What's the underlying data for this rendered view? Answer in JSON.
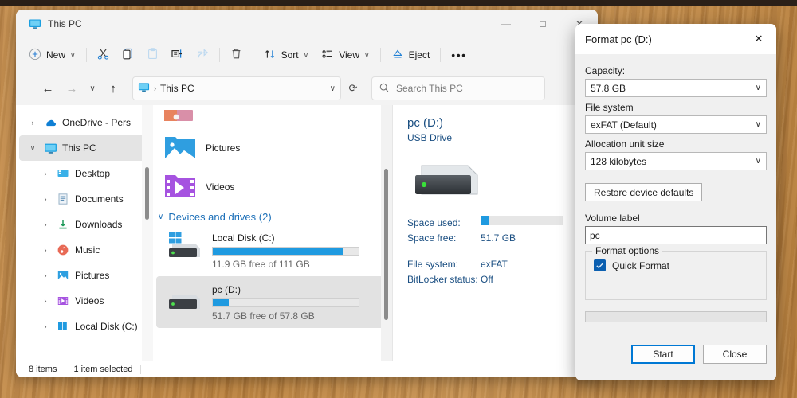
{
  "window": {
    "title": "This PC",
    "title_icon": "monitor-icon",
    "controls": {
      "minimize": "—",
      "maximize": "□",
      "close": "✕"
    }
  },
  "toolbar": {
    "new_label": "New",
    "new_icon": "plus-circle-icon",
    "chevron": "∨",
    "cut_icon": "scissors-icon",
    "copy_icon": "copy-icon",
    "paste_icon": "paste-icon",
    "rename_icon": "rename-icon",
    "share_icon": "share-icon",
    "delete_icon": "trash-icon",
    "sort_label": "Sort",
    "sort_icon": "sort-arrows-icon",
    "view_label": "View",
    "view_icon": "view-list-icon",
    "eject_label": "Eject",
    "eject_icon": "eject-icon",
    "overflow": "•••"
  },
  "address": {
    "back_icon": "←",
    "forward_icon": "→",
    "recent_icon": "∨",
    "up_icon": "↑",
    "crumb_icon": "monitor-icon",
    "crumb_sep": "›",
    "crumb": "This PC",
    "dropdown_icon": "∨",
    "refresh_icon": "⟳"
  },
  "search": {
    "icon": "search-icon",
    "placeholder": "Search This PC"
  },
  "sidebar": {
    "items": [
      {
        "label": "OneDrive - Pers",
        "icon": "onedrive-icon",
        "twisty": "›",
        "indent": false,
        "selected": false
      },
      {
        "label": "This PC",
        "icon": "monitor-icon",
        "twisty": "∨",
        "indent": false,
        "selected": true
      },
      {
        "label": "Desktop",
        "icon": "desktop-icon",
        "twisty": "›",
        "indent": true,
        "selected": false
      },
      {
        "label": "Documents",
        "icon": "documents-icon",
        "twisty": "›",
        "indent": true,
        "selected": false
      },
      {
        "label": "Downloads",
        "icon": "downloads-icon",
        "twisty": "›",
        "indent": true,
        "selected": false
      },
      {
        "label": "Music",
        "icon": "music-icon",
        "twisty": "›",
        "indent": true,
        "selected": false
      },
      {
        "label": "Pictures",
        "icon": "pictures-icon",
        "twisty": "›",
        "indent": true,
        "selected": false
      },
      {
        "label": "Videos",
        "icon": "videos-icon",
        "twisty": "›",
        "indent": true,
        "selected": false
      },
      {
        "label": "Local Disk (C:)",
        "icon": "localdisk-icon",
        "twisty": "›",
        "indent": true,
        "selected": false
      }
    ]
  },
  "content": {
    "folders": [
      {
        "label": "",
        "icon": "music-icon"
      },
      {
        "label": "Pictures",
        "icon": "pictures-icon"
      },
      {
        "label": "Videos",
        "icon": "videos-icon"
      }
    ],
    "group_header": "Devices and drives (2)",
    "group_chevron": "∨",
    "drives": [
      {
        "name": "Local Disk (C:)",
        "icon": "windows-drive-icon",
        "free_text": "11.9 GB free of 111 GB",
        "used_percent": 89,
        "selected": false
      },
      {
        "name": "pc (D:)",
        "icon": "usb-drive-icon",
        "free_text": "51.7 GB free of 57.8 GB",
        "used_percent": 11,
        "selected": true
      }
    ]
  },
  "details": {
    "title": "pc (D:)",
    "subtitle": "USB Drive",
    "icon": "usb-drive-large-icon",
    "space_used_label": "Space used:",
    "space_used_percent": 11,
    "space_free_label": "Space free:",
    "space_free_value": "51.7 GB",
    "file_system_label": "File system:",
    "file_system_value": "exFAT",
    "bitlocker_label": "BitLocker status:",
    "bitlocker_value": "Off"
  },
  "statusbar": {
    "items_count": "8 items",
    "selection": "1 item selected",
    "details_view_icon": "details-view-icon",
    "large_icons_view_icon": "large-icons-view-icon"
  },
  "dialog": {
    "title": "Format pc (D:)",
    "close_icon": "✕",
    "capacity_label": "Capacity:",
    "capacity_value": "57.8 GB",
    "file_system_label": "File system",
    "file_system_value": "exFAT (Default)",
    "allocation_label": "Allocation unit size",
    "allocation_value": "128 kilobytes",
    "restore_defaults_label": "Restore device defaults",
    "volume_label_label": "Volume label",
    "volume_label_value": "pc",
    "format_options_legend": "Format options",
    "quick_format_label": "Quick Format",
    "quick_format_checked": true,
    "check_glyph": "✓",
    "chevron": "∨",
    "start_label": "Start",
    "close_label": "Close",
    "progress_percent": 0,
    "accent_color": "#0078d4"
  }
}
